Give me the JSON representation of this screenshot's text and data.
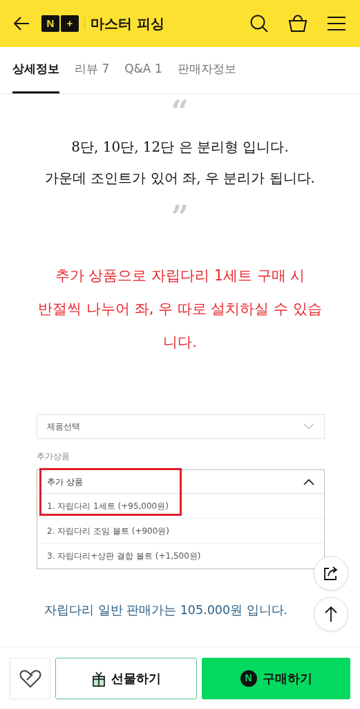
{
  "header": {
    "logo_letters": [
      "N",
      "+"
    ],
    "store_name": "마스터 피싱"
  },
  "tabs": [
    {
      "label": "상세정보",
      "selected": true
    },
    {
      "label": "리뷰 7",
      "selected": false
    },
    {
      "label": "Q&A 1",
      "selected": false
    },
    {
      "label": "판매자정보",
      "selected": false
    }
  ],
  "quote": {
    "open": "“",
    "lines": [
      "8단, 10단, 12단 은 분리형 입니다.",
      "가운데 조인트가 있어 좌, 우 분리가 됩니다."
    ],
    "close": "”"
  },
  "notice_lines": [
    "추가 상품으로 자립다리 1세트 구매 시",
    "반절씩 나누어 좌, 우 따로 설치하실 수 있습",
    "니다."
  ],
  "option_screenshot": {
    "product_select": {
      "placeholder": "제품선택"
    },
    "addon_label": "추가상품",
    "addon_select": {
      "value": "추가 상품",
      "expanded": true,
      "options": [
        {
          "label": "1. 자립다리 1세트 (+95,000원)",
          "highlighted": true
        },
        {
          "label": "2. 자립다리 조임 볼트 (+900원)",
          "highlighted": false
        },
        {
          "label": "3. 자립다리+상판 결합 볼트 (+1,500원)",
          "highlighted": false
        }
      ]
    }
  },
  "price_note": "자립다리 일반 판매가는 105.000원 입니다.",
  "bottom_bar": {
    "gift_button": "선물하기",
    "buy_button": {
      "icon_letter": "N",
      "label": "구매하기"
    }
  }
}
